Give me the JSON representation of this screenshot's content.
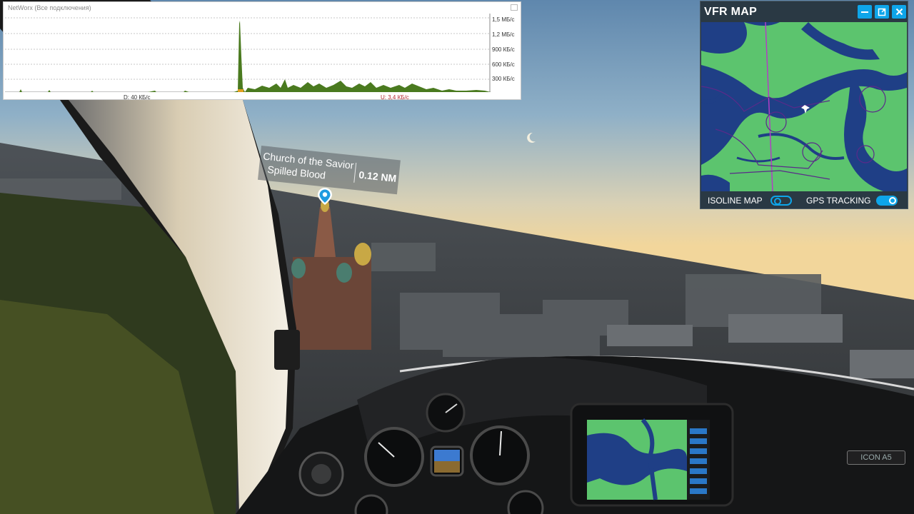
{
  "network_monitor": {
    "title": "NetWorx (Все подключения)",
    "y_labels": [
      "1,5 МБ/с",
      "1,2 МБ/с",
      "900 КБ/с",
      "600 КБ/с",
      "300 КБ/с"
    ],
    "download_label": "D: 40 КБ/с",
    "upload_label": "U: 3,4 КБ/с",
    "colors": {
      "download": "#4a7a1f",
      "upload": "#e0a020",
      "grid": "#b5b5b5"
    }
  },
  "vfr_map": {
    "title": "VFR MAP",
    "buttons": [
      {
        "name": "minimize",
        "icon": "minus-icon"
      },
      {
        "name": "popout",
        "icon": "external-window-icon"
      },
      {
        "name": "close",
        "icon": "close-icon"
      }
    ],
    "isoline_label": "ISOLINE MAP",
    "isoline_on": false,
    "gps_label": "GPS TRACKING",
    "gps_on": true,
    "colors": {
      "land": "#5cc46e",
      "water": "#1f3f86",
      "accent": "#0ea5e9",
      "header": "#2a3944"
    }
  },
  "landmark": {
    "name_line1": "Church of the Savior",
    "name_line2": "Spilled Blood",
    "distance": "0.12 NM",
    "pin_icon": "map-pin-icon"
  },
  "cockpit": {
    "logo": "ICON A5",
    "instruments": [
      "AIRSPEED",
      "ALTITUDE"
    ]
  }
}
